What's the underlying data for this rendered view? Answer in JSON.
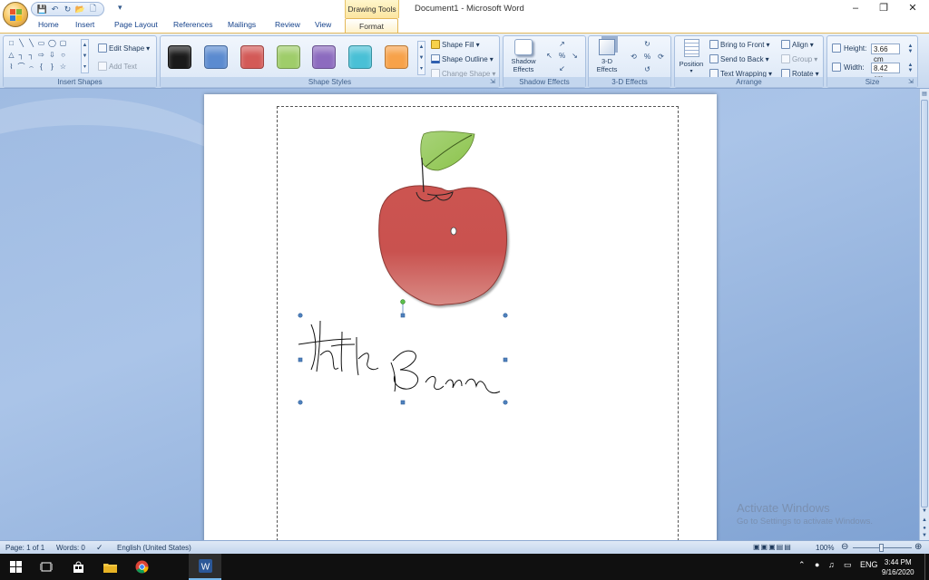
{
  "window": {
    "title": "Document1 - Microsoft Word",
    "context_tab": "Drawing Tools",
    "min_glyph": "–",
    "max_glyph": "❐",
    "close_glyph": "✕"
  },
  "qat": {
    "caret": "▾"
  },
  "tabs": [
    "Home",
    "Insert",
    "Page Layout",
    "References",
    "Mailings",
    "Review",
    "View",
    "Format"
  ],
  "ribbon": {
    "insert_shapes": {
      "label": "Insert Shapes",
      "edit_shape": "Edit Shape",
      "add_text": "Add Text",
      "shapes": [
        "□",
        "╲",
        "╲",
        "▭",
        "◯",
        "▢",
        "△",
        "┐",
        "┐",
        "⇨",
        "⇩",
        "○",
        "⌇",
        "⌒",
        "⌢",
        "{",
        "}",
        "☆"
      ]
    },
    "shape_styles": {
      "label": "Shape Styles",
      "shape_fill": "Shape Fill",
      "shape_outline": "Shape Outline",
      "change_shape": "Change Shape",
      "swatches": [
        "#1a1a1a",
        "#5b8bd0",
        "#d35a57",
        "#9fcd6a",
        "#8c6bbf",
        "#49c0d6",
        "#f7a24a"
      ]
    },
    "shadow_effects": {
      "label": "Shadow Effects",
      "button": "Shadow Effects"
    },
    "three_d_effects": {
      "label": "3-D Effects",
      "button": "3-D Effects"
    },
    "arrange": {
      "label": "Arrange",
      "position": "Position",
      "bring_to_front": "Bring to Front",
      "send_to_back": "Send to Back",
      "text_wrapping": "Text Wrapping",
      "align": "Align",
      "group": "Group",
      "rotate": "Rotate"
    },
    "size": {
      "label": "Size",
      "height_label": "Height:",
      "height_value": "3.66 cm",
      "width_label": "Width:",
      "width_value": "8.42 cm"
    }
  },
  "document": {
    "apple_colors": {
      "top": "#cc5450",
      "mid": "#c9524f",
      "bottom": "#d98b86",
      "leaf": "#8bc34a"
    }
  },
  "watermark": {
    "line1": "Activate Windows",
    "line2": "Go to Settings to activate Windows."
  },
  "status": {
    "page": "Page: 1 of 1",
    "words": "Words: 0",
    "language": "English (United States)",
    "zoom": "100%"
  },
  "taskbar": {
    "lang": "ENG",
    "time": "3:44 PM",
    "date": "9/16/2020"
  }
}
